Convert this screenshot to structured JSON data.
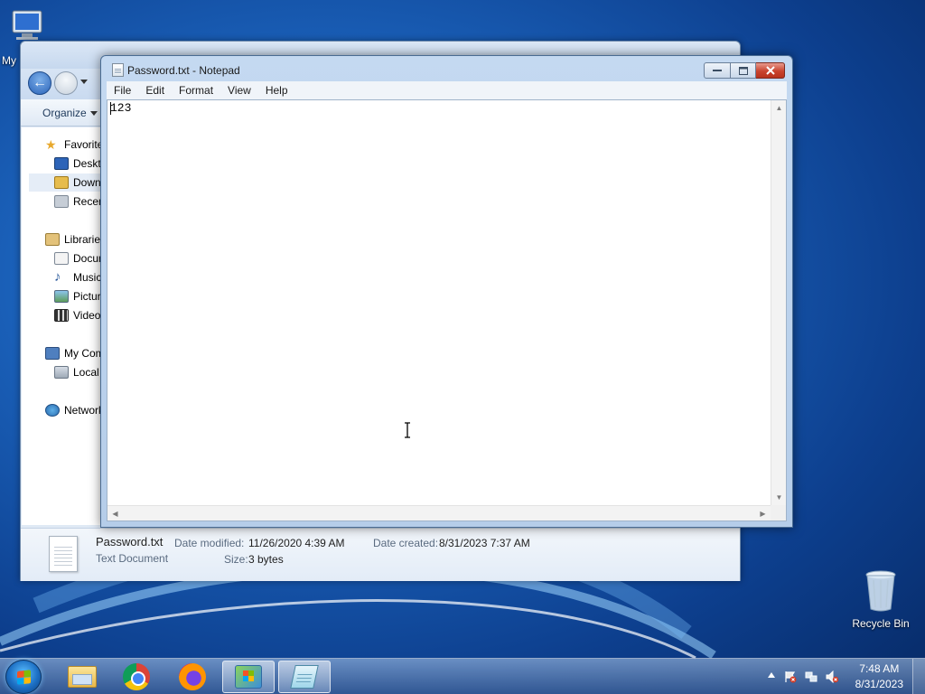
{
  "desktop": {
    "icons": [
      {
        "label": "My"
      },
      {
        "label": "Recycle Bin"
      }
    ]
  },
  "explorer": {
    "organize_label": "Organize",
    "nav_items": [
      {
        "label": "Favorites"
      },
      {
        "label": "Desktop"
      },
      {
        "label": "Downloads"
      },
      {
        "label": "Recent Places"
      },
      {
        "label": "Libraries"
      },
      {
        "label": "Documents"
      },
      {
        "label": "Music"
      },
      {
        "label": "Pictures"
      },
      {
        "label": "Videos"
      },
      {
        "label": "My Computer"
      },
      {
        "label": "Local Disk"
      },
      {
        "label": "Network"
      }
    ],
    "details": {
      "file_name": "Password.txt",
      "file_type": "Text Document",
      "date_modified_label": "Date modified:",
      "date_modified_value": "11/26/2020 4:39 AM",
      "date_created_label": "Date created:",
      "date_created_value": "8/31/2023 7:37 AM",
      "size_label": "Size:",
      "size_value": "3 bytes"
    }
  },
  "notepad": {
    "title": "Password.txt - Notepad",
    "menus": [
      "File",
      "Edit",
      "Format",
      "View",
      "Help"
    ],
    "content": "123"
  },
  "taskbar": {
    "clock_time": "7:48 AM",
    "clock_date": "8/31/2023",
    "pinned": [
      "windows-explorer-icon",
      "chrome-icon",
      "firefox-icon",
      "app-icon",
      "notepad-icon"
    ]
  },
  "colors": {
    "close_button": "#c9432e",
    "desktop_accent": "#1b62bb"
  }
}
